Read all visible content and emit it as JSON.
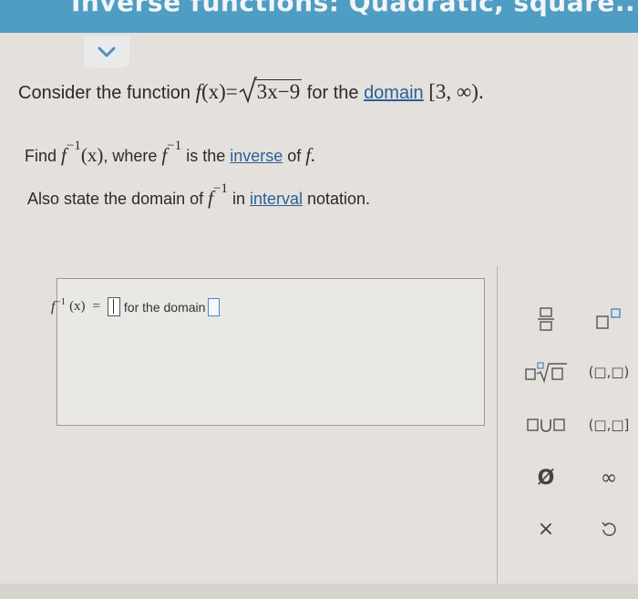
{
  "header": {
    "title": "Inverse functions: Quadratic, square..."
  },
  "question": {
    "line1_prefix": "Consider the function ",
    "function_f": "f",
    "function_x": "(x)",
    "equals": "=",
    "radicand": "3x−9",
    "line1_middle": " for the ",
    "domain_link": "domain",
    "domain_value": "[3, ∞)",
    "period": ".",
    "line2_prefix": "Find ",
    "inv_f": "f",
    "inv_sup": "−1",
    "inv_x": "(x)",
    "line2_middle": ", where ",
    "line2_mid2": " is the ",
    "inverse_link": "inverse",
    "line2_of": " of ",
    "f_end": "f.",
    "line3_prefix": "Also state the domain of ",
    "line3_middle": " in ",
    "interval_link": "interval",
    "line3_suffix": " notation."
  },
  "answer": {
    "f": "f",
    "sup": "−1",
    "x": "(x)",
    "equals": "=",
    "domain_label": "for the domain"
  },
  "keypad": {
    "open_interval": "(□,□)",
    "half_open_interval": "(□,□]",
    "empty_set": "Ø",
    "infinity": "∞",
    "clear": "×"
  },
  "colors": {
    "header": "#4f9dc3",
    "link": "#2b5f9a",
    "accent": "#4f86c6"
  }
}
